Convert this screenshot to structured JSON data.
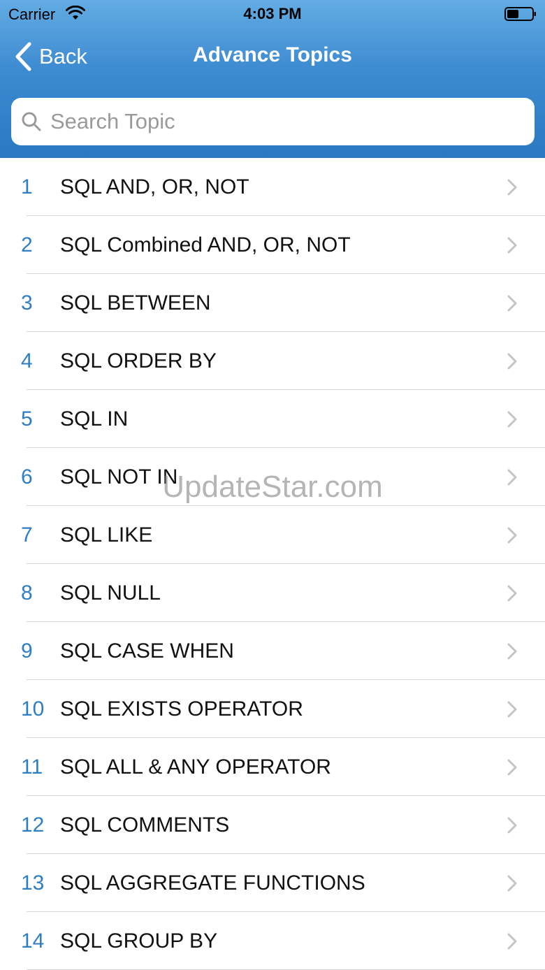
{
  "status_bar": {
    "carrier": "Carrier",
    "time": "4:03 PM"
  },
  "nav": {
    "back_label": "Back",
    "title": "Advance Topics"
  },
  "search": {
    "placeholder": "Search Topic",
    "value": ""
  },
  "topics": [
    {
      "num": "1",
      "label": "SQL AND, OR, NOT"
    },
    {
      "num": "2",
      "label": "SQL Combined AND, OR, NOT"
    },
    {
      "num": "3",
      "label": "SQL BETWEEN"
    },
    {
      "num": "4",
      "label": "SQL ORDER BY"
    },
    {
      "num": "5",
      "label": "SQL IN"
    },
    {
      "num": "6",
      "label": "SQL NOT IN"
    },
    {
      "num": "7",
      "label": "SQL LIKE"
    },
    {
      "num": "8",
      "label": "SQL NULL"
    },
    {
      "num": "9",
      "label": "SQL CASE WHEN"
    },
    {
      "num": "10",
      "label": "SQL EXISTS OPERATOR"
    },
    {
      "num": "11",
      "label": "SQL ALL & ANY OPERATOR"
    },
    {
      "num": "12",
      "label": "SQL COMMENTS"
    },
    {
      "num": "13",
      "label": "SQL AGGREGATE FUNCTIONS"
    },
    {
      "num": "14",
      "label": "SQL GROUP BY"
    }
  ],
  "watermark": "UpdateStar.com",
  "colors": {
    "header_top": "#63ace3",
    "header_bottom": "#2a79c1",
    "number_accent": "#2f7ec4",
    "chevron": "#c4c4c8"
  },
  "icons": {
    "back": "chevron-left-icon",
    "search": "search-icon",
    "row_disclosure": "chevron-right-icon",
    "wifi": "wifi-icon",
    "battery": "battery-icon"
  }
}
